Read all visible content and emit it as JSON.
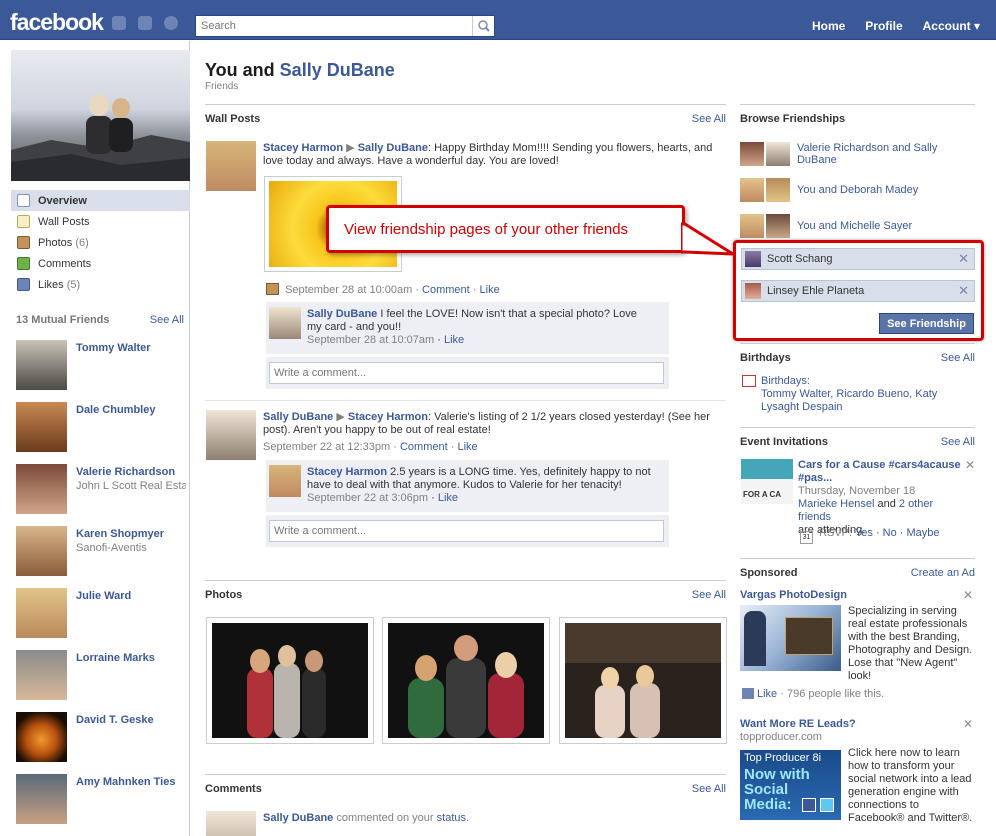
{
  "header": {
    "logo": "facebook",
    "search_placeholder": "Search",
    "nav": [
      "Home",
      "Profile",
      "Account ▾"
    ]
  },
  "left_nav": {
    "items": [
      {
        "label": "Overview",
        "count": ""
      },
      {
        "label": "Wall Posts",
        "count": ""
      },
      {
        "label": "Photos",
        "count": "(6)"
      },
      {
        "label": "Comments",
        "count": ""
      },
      {
        "label": "Likes",
        "count": "(5)"
      }
    ],
    "mutual_title": "13 Mutual Friends",
    "see_all": "See All",
    "friends": [
      {
        "name": "Tommy Walter",
        "sub": ""
      },
      {
        "name": "Dale Chumbley",
        "sub": ""
      },
      {
        "name": "Valerie Richardson",
        "sub": "John L Scott Real Estate"
      },
      {
        "name": "Karen Shopmyer",
        "sub": "Sanofi-Aventis"
      },
      {
        "name": "Julie Ward",
        "sub": ""
      },
      {
        "name": "Lorraine Marks",
        "sub": ""
      },
      {
        "name": "David T. Geske",
        "sub": ""
      },
      {
        "name": "Amy Mahnken Ties",
        "sub": ""
      }
    ]
  },
  "page": {
    "title_prefix": "You and ",
    "title_name": "Sally DuBane",
    "subtitle": "Friends"
  },
  "wall": {
    "title": "Wall Posts",
    "see_all": "See All",
    "post1": {
      "from": "Stacey Harmon",
      "to": "Sally DuBane",
      "text": ": Happy Birthday Mom!!!! Sending you flowers, hearts, and love today and always. Have a wonderful day. You are loved!",
      "time": "September 28 at 10:00am",
      "comment": "Comment",
      "like": "Like",
      "reply_name": "Sally DuBane",
      "reply_text": " I feel the LOVE! Now isn't that a special photo? Love my card - and you!!",
      "reply_time": "September 28 at 10:07am",
      "reply_like": "Like",
      "write_placeholder": "Write a comment..."
    },
    "post2": {
      "from": "Sally DuBane",
      "to": "Stacey Harmon",
      "text": ": Valerie's listing of 2 1/2 years closed yesterday! (See her post). Aren't you happy to be out of real estate!",
      "time": "September 22 at 12:33pm",
      "comment": "Comment",
      "like": "Like",
      "reply_name": "Stacey Harmon",
      "reply_text": " 2.5 years is a LONG time. Yes, definitely happy to not have to deal with that anymore. Kudos to Valerie for her tenacity!",
      "reply_time": "September 22 at 3:06pm",
      "reply_like": "Like",
      "write_placeholder": "Write a comment..."
    }
  },
  "photos": {
    "title": "Photos",
    "see_all": "See All"
  },
  "comments": {
    "title": "Comments",
    "see_all": "See All",
    "first_name": "Sally DuBane",
    "first_text": " commented on your ",
    "first_link": "status",
    "first_end": "."
  },
  "callout": {
    "text": "View friendship pages of your other friends"
  },
  "browse": {
    "title": "Browse Friendships",
    "rows": [
      "Valerie Richardson and Sally DuBane",
      "You and Deborah Madey",
      "You and Michelle Sayer"
    ],
    "chips": [
      "Scott Schang",
      "Linsey Ehle Planeta"
    ],
    "button": "See Friendship"
  },
  "birthdays": {
    "title": "Birthdays",
    "see_all": "See All",
    "label": "Birthdays:",
    "names": "Tommy Walter, Ricardo Bueno, Katy Lysaght Despain"
  },
  "events": {
    "title": "Event Invitations",
    "see_all": "See All",
    "name": "Cars for a Cause #cars4acause #pas...",
    "date": "Thursday, November 18",
    "attending_name": "Marieke Hensel",
    "attending_mid": " and ",
    "attending_others": "2 other friends",
    "attending_end": "are attending.",
    "rsvp": "RSVP:",
    "yes": "Yes",
    "no": "No",
    "maybe": "Maybe",
    "cal_day": "31",
    "thumb_text": "FOR A CA"
  },
  "sponsored": {
    "title": "Sponsored",
    "create": "Create an Ad",
    "ad1": {
      "title": "Vargas PhotoDesign",
      "text": "Specializing in serving real estate professionals with the best Branding, Photography and Design. Lose that \"New Agent\" look!",
      "like": "Like",
      "likes_text": " · 796 people like this."
    },
    "ad2": {
      "title": "Want More RE Leads?",
      "url": "topproducer.com",
      "text": "Click here now to learn how to transform your social network into a lead generation engine with connections to Facebook® and Twitter®.",
      "img_line1": "Top Producer 8i",
      "img_line2": "Now with",
      "img_line3": "Social",
      "img_line4": "Media:"
    }
  }
}
